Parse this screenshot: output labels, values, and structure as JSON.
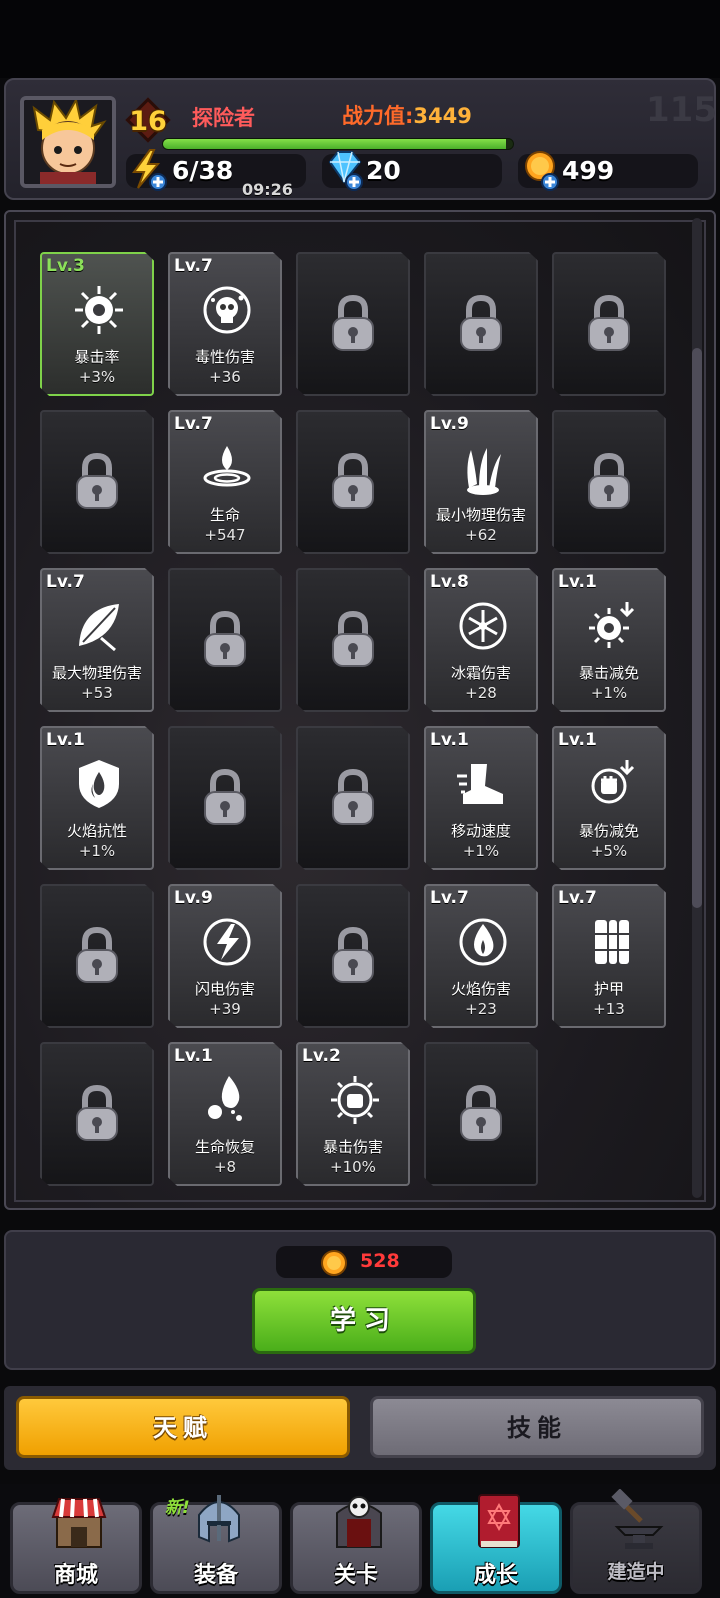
{
  "header": {
    "player_level": "16",
    "player_title": "探险者",
    "power_label": "战力值:",
    "power_value": "3449",
    "xp_progress": 0.98,
    "faint_number": "115",
    "energy": "6/38",
    "energy_timer": "09:26",
    "gems": "20",
    "coins": "499"
  },
  "talents": [
    {
      "level": "Lv.3",
      "name": "暴击率",
      "value": "+3%",
      "icon": "crit-rate-icon",
      "selected": true
    },
    {
      "level": "Lv.7",
      "name": "毒性伤害",
      "value": "+36",
      "icon": "poison-skull-icon"
    },
    {
      "locked": true
    },
    {
      "locked": true
    },
    {
      "locked": true
    },
    {
      "locked": true
    },
    {
      "level": "Lv.7",
      "name": "生命",
      "value": "+547",
      "icon": "water-drop-icon"
    },
    {
      "locked": true
    },
    {
      "level": "Lv.9",
      "name": "最小物理伤害",
      "value": "+62",
      "icon": "claw-icon"
    },
    {
      "locked": true
    },
    {
      "level": "Lv.7",
      "name": "最大物理伤害",
      "value": "+53",
      "icon": "leaf-blade-icon"
    },
    {
      "locked": true
    },
    {
      "locked": true
    },
    {
      "level": "Lv.8",
      "name": "冰霜伤害",
      "value": "+28",
      "icon": "snowflake-icon"
    },
    {
      "level": "Lv.1",
      "name": "暴击减免",
      "value": "+1%",
      "icon": "crit-reduce-icon"
    },
    {
      "level": "Lv.1",
      "name": "火焰抗性",
      "value": "+1%",
      "icon": "fire-shield-icon"
    },
    {
      "locked": true
    },
    {
      "locked": true
    },
    {
      "level": "Lv.1",
      "name": "移动速度",
      "value": "+1%",
      "icon": "speed-boot-icon"
    },
    {
      "level": "Lv.1",
      "name": "暴伤减免",
      "value": "+5%",
      "icon": "fist-reduce-icon"
    },
    {
      "locked": true
    },
    {
      "level": "Lv.9",
      "name": "闪电伤害",
      "value": "+39",
      "icon": "lightning-icon"
    },
    {
      "locked": true
    },
    {
      "level": "Lv.7",
      "name": "火焰伤害",
      "value": "+23",
      "icon": "fire-icon"
    },
    {
      "level": "Lv.7",
      "name": "护甲",
      "value": "+13",
      "icon": "armor-icon"
    },
    {
      "locked": true
    },
    {
      "level": "Lv.1",
      "name": "生命恢复",
      "value": "+8",
      "icon": "regen-drops-icon"
    },
    {
      "level": "Lv.2",
      "name": "暴击伤害",
      "value": "+10%",
      "icon": "crit-fist-icon"
    },
    {
      "locked": true
    }
  ],
  "learn": {
    "cost": "528",
    "button_label": "学习"
  },
  "tabs": {
    "talent_label": "天赋",
    "skill_label": "技能"
  },
  "nav": {
    "shop": "商城",
    "equipment": "装备",
    "equipment_badge": "新!",
    "stages": "关卡",
    "growth": "成长",
    "building": "建造中"
  },
  "colors": {
    "accent_green": "#7fd24a",
    "accent_yellow": "#f0a000",
    "accent_cyan": "#1a9fb4",
    "cost_red": "#ff3a3a"
  }
}
